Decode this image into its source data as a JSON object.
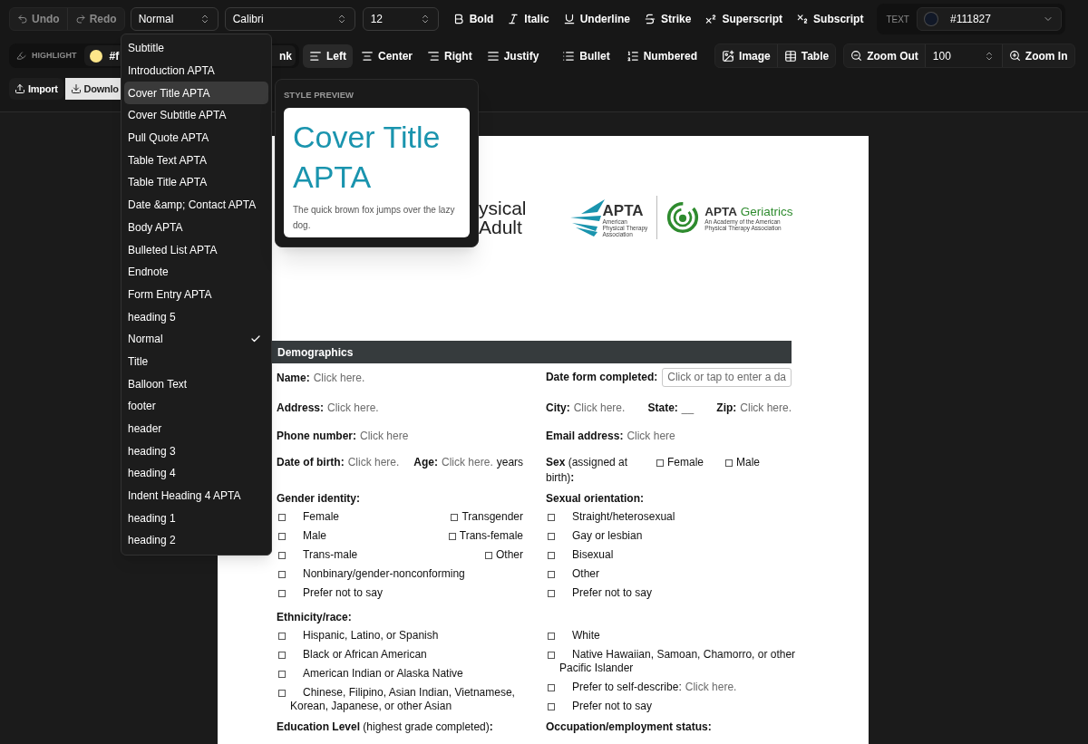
{
  "toolbar": {
    "history": [
      {
        "label": "Undo",
        "kind": "undo",
        "disabled": true
      },
      {
        "label": "Redo",
        "kind": "redo",
        "disabled": true
      }
    ],
    "style_select": {
      "value": "Normal"
    },
    "font_select": {
      "value": "Calibri"
    },
    "size_select": {
      "value": "12"
    },
    "format_buttons": [
      {
        "label": "Bold",
        "kind": "bold"
      },
      {
        "label": "Italic",
        "kind": "italic"
      },
      {
        "label": "Underline",
        "kind": "underline"
      },
      {
        "label": "Strike",
        "kind": "strike"
      },
      {
        "label": "Superscript",
        "kind": "superscript"
      },
      {
        "label": "Subscript",
        "kind": "subscript"
      }
    ],
    "text_color": {
      "label": "TEXT",
      "value": "#111827",
      "color": "#111827"
    },
    "highlight": {
      "label": "HIGHLIGHT",
      "value": "#f",
      "color": "#fde68a"
    },
    "link_button": {
      "label": "nk"
    },
    "align_buttons": [
      {
        "label": "Left",
        "kind": "left",
        "selected": true
      },
      {
        "label": "Center",
        "kind": "center",
        "selected": false
      },
      {
        "label": "Right",
        "kind": "right",
        "selected": false
      },
      {
        "label": "Justify",
        "kind": "justify",
        "selected": false
      }
    ],
    "list_buttons": [
      {
        "label": "Bullet",
        "kind": "bullet"
      },
      {
        "label": "Numbered",
        "kind": "numbered"
      }
    ],
    "insert_buttons": [
      {
        "label": "Image",
        "kind": "image"
      },
      {
        "label": "Table",
        "kind": "table"
      }
    ],
    "zoom": {
      "out_label": "Zoom Out",
      "value": "100",
      "in_label": "Zoom In"
    },
    "file_buttons": [
      {
        "label": "Import",
        "kind": "import",
        "selected": false
      },
      {
        "label": "Downlo",
        "kind": "download",
        "selected": true
      }
    ]
  },
  "style_menu": {
    "items": [
      {
        "label": "Subtitle",
        "selected": false,
        "hovered": false
      },
      {
        "label": "Introduction APTA",
        "selected": false,
        "hovered": false
      },
      {
        "label": "Cover Title APTA",
        "selected": false,
        "hovered": true
      },
      {
        "label": "Cover Subtitle APTA",
        "selected": false,
        "hovered": false
      },
      {
        "label": "Pull Quote APTA",
        "selected": false,
        "hovered": false
      },
      {
        "label": "Table Text APTA",
        "selected": false,
        "hovered": false
      },
      {
        "label": "Table Title APTA",
        "selected": false,
        "hovered": false
      },
      {
        "label": "Date &amp; Contact APTA",
        "selected": false,
        "hovered": false
      },
      {
        "label": "Body APTA",
        "selected": false,
        "hovered": false
      },
      {
        "label": "Bulleted List APTA",
        "selected": false,
        "hovered": false
      },
      {
        "label": "Endnote",
        "selected": false,
        "hovered": false
      },
      {
        "label": "Form Entry APTA",
        "selected": false,
        "hovered": false
      },
      {
        "label": "heading 5",
        "selected": false,
        "hovered": false
      },
      {
        "label": "Normal",
        "selected": true,
        "hovered": false
      },
      {
        "label": "Title",
        "selected": false,
        "hovered": false
      },
      {
        "label": "Balloon Text",
        "selected": false,
        "hovered": false
      },
      {
        "label": "footer",
        "selected": false,
        "hovered": false
      },
      {
        "label": "header",
        "selected": false,
        "hovered": false
      },
      {
        "label": "heading 3",
        "selected": false,
        "hovered": false
      },
      {
        "label": "heading 4",
        "selected": false,
        "hovered": false
      },
      {
        "label": "Indent Heading 4 APTA",
        "selected": false,
        "hovered": false
      },
      {
        "label": "heading 1",
        "selected": false,
        "hovered": false
      },
      {
        "label": "heading 2",
        "selected": false,
        "hovered": false
      }
    ]
  },
  "style_preview": {
    "heading": "STYLE PREVIEW",
    "title": "Cover Title APTA",
    "sample": "The quick brown fox jumps over the lazy dog."
  },
  "document": {
    "title_lines": [
      "ysical",
      "Adult"
    ],
    "apta_logo": {
      "name": "APTA",
      "caption": [
        "American",
        "Physical Therapy",
        "Association"
      ]
    },
    "geriatrics_logo": {
      "name": "APTA",
      "name_accent": "Geriatrics",
      "caption": [
        "An Academy of the American",
        "Physical Therapy Association"
      ]
    },
    "section": "Demographics",
    "rows": [
      {
        "left": [
          {
            "label": "Name:",
            "value": "Click here."
          }
        ],
        "right": [
          {
            "label": "Date form completed:",
            "input": "Click or tap to enter a da"
          }
        ]
      },
      {
        "left": [
          {
            "label": "Address:",
            "value": "Click here."
          }
        ],
        "right": [
          {
            "label": "City:",
            "value": "Click here."
          },
          {
            "label": "State:",
            "value": "__"
          },
          {
            "label": "Zip:",
            "value": "Click here."
          }
        ]
      },
      {
        "left": [
          {
            "label": "Phone number:",
            "value": "Click here"
          }
        ],
        "right": [
          {
            "label": "Email address:",
            "value": "Click here"
          }
        ]
      },
      {
        "left": [
          {
            "label": "Date of birth:",
            "value": "Click here."
          },
          {
            "label": "Age:",
            "value": "Click here.",
            "suffix": "years"
          }
        ],
        "right": [
          {
            "label_rich": "**Sex** (assigned at birth)**:**",
            "options": [
              {
                "label": "Female",
                "checked": false
              },
              {
                "label": "Male",
                "checked": false
              }
            ]
          }
        ]
      }
    ],
    "groups": [
      {
        "left": {
          "heading": "Gender identity:",
          "rows": [
            [
              {
                "label": "Female",
                "checked": false
              },
              {
                "label": "Transgender",
                "checked": false
              }
            ],
            [
              {
                "label": "Male",
                "checked": false
              },
              {
                "label": "Trans-female",
                "checked": false
              }
            ],
            [
              {
                "label": "Trans-male",
                "checked": false
              },
              {
                "label": "Other",
                "checked": false
              }
            ],
            [
              {
                "label": "Nonbinary/gender-nonconforming",
                "checked": false
              }
            ],
            [
              {
                "label": "Prefer not to say",
                "checked": false
              }
            ]
          ]
        },
        "right": {
          "heading": "Sexual orientation:",
          "rows": [
            [
              {
                "label": "Straight/heterosexual",
                "checked": false
              }
            ],
            [
              {
                "label": "Gay or lesbian",
                "checked": false
              }
            ],
            [
              {
                "label": "Bisexual",
                "checked": false
              }
            ],
            [
              {
                "label": "Other",
                "checked": false
              }
            ],
            [
              {
                "label": "Prefer not to say",
                "checked": false
              }
            ]
          ]
        }
      },
      {
        "left": {
          "heading": "Ethnicity/race:",
          "rows": [
            [
              {
                "label": "Hispanic, Latino, or Spanish",
                "checked": false
              }
            ],
            [
              {
                "label": "Black or African American",
                "checked": false
              }
            ],
            [
              {
                "label": "American Indian or Alaska Native",
                "checked": false
              }
            ],
            [
              {
                "label": "Chinese, Filipino, Asian Indian, Vietnamese, Korean, Japanese, or other Asian",
                "checked": false
              }
            ]
          ]
        },
        "right": {
          "rows": [
            [
              {
                "label": "White",
                "checked": false
              }
            ],
            [
              {
                "label": "Native Hawaiian, Samoan, Chamorro, or other Pacific Islander",
                "checked": false
              }
            ],
            [
              {
                "label": "Prefer to self-describe:",
                "value": "Click here.",
                "checked": false
              }
            ],
            [
              {
                "label": "Prefer not to say",
                "checked": false
              }
            ]
          ]
        }
      }
    ],
    "footer_row": {
      "left": {
        "label_rich": "**Education Level** (highest grade completed)**:**"
      },
      "right": {
        "label": "Occupation/employment status:"
      }
    }
  }
}
